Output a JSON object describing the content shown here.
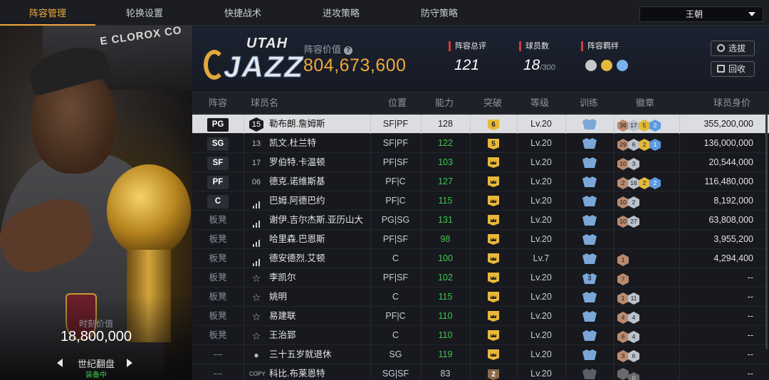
{
  "nav": {
    "tabs": [
      "阵容管理",
      "轮换设置",
      "快捷战术",
      "进攻策略",
      "防守策略"
    ],
    "active_tab": "阵容管理",
    "team_select": "王朝"
  },
  "card": {
    "wall_text": "E CLOROX CO",
    "value_label": "时刻价值",
    "value": "18,800,000",
    "name": "世纪翻盘",
    "status": "装备中"
  },
  "team": {
    "logo_top": "UTAH",
    "logo_main": "JAZZ",
    "lineup_value_label": "阵容价值",
    "lineup_value": "804,673,600",
    "rating_label": "阵容总评",
    "rating": "121",
    "players_label": "球员数",
    "players": "18",
    "players_max": "/300",
    "bond_label": "阵容羁绊",
    "bonds": [
      "#c8c8c8",
      "#e0b93d",
      "#7ab2ee"
    ],
    "btn_pick": "选拔",
    "btn_recycle": "回收"
  },
  "table": {
    "headers": [
      "阵容",
      "球员名",
      "位置",
      "能力",
      "突破",
      "等级",
      "训练",
      "徽章",
      "球员身价"
    ],
    "rows": [
      {
        "slot": "PG",
        "jersey": "15",
        "name": "勒布朗.詹姆斯",
        "pos": "SF|PF",
        "ability": "128",
        "ability_green": false,
        "brk": "6",
        "brk_type": "num",
        "level": "Lv.20",
        "train": "",
        "train_type": "blue",
        "badges": [
          [
            "br",
            "36"
          ],
          [
            "si",
            "17"
          ],
          [
            "go",
            "5"
          ],
          [
            "bl",
            "2"
          ]
        ],
        "salary": "355,200,000",
        "selected": true
      },
      {
        "slot": "SG",
        "jersey": "13",
        "name": "凯文.杜兰特",
        "pos": "SF|PF",
        "ability": "122",
        "ability_green": true,
        "brk": "5",
        "brk_type": "num",
        "level": "Lv.20",
        "train": "",
        "train_type": "blue",
        "badges": [
          [
            "br",
            "29"
          ],
          [
            "si",
            "6"
          ],
          [
            "go",
            "2"
          ],
          [
            "bl",
            "1"
          ]
        ],
        "salary": "136,000,000",
        "selected": false
      },
      {
        "slot": "SF",
        "jersey": "17",
        "name": "罗伯特.卡温顿",
        "pos": "PF|SF",
        "ability": "103",
        "ability_green": true,
        "brk": "",
        "brk_type": "crown",
        "level": "Lv.20",
        "train": "",
        "train_type": "blue",
        "badges": [
          [
            "br",
            "10"
          ],
          [
            "si",
            "3"
          ]
        ],
        "salary": "20,544,000",
        "selected": false
      },
      {
        "slot": "PF",
        "jersey": "06",
        "name": "德克.诺维斯基",
        "pos": "PF|C",
        "ability": "127",
        "ability_green": true,
        "brk": "",
        "brk_type": "crown",
        "level": "Lv.20",
        "train": "",
        "train_type": "blue",
        "badges": [
          [
            "br",
            "2"
          ],
          [
            "si",
            "16"
          ],
          [
            "go",
            "2"
          ],
          [
            "bl",
            "2"
          ]
        ],
        "salary": "116,480,000",
        "selected": false
      },
      {
        "slot": "C",
        "jersey": "bars",
        "name": "巴姆.阿德巴约",
        "pos": "PF|C",
        "ability": "115",
        "ability_green": true,
        "brk": "",
        "brk_type": "crown",
        "level": "Lv.20",
        "train": "",
        "train_type": "blue",
        "badges": [
          [
            "br",
            "10"
          ],
          [
            "si",
            "2"
          ]
        ],
        "salary": "8,192,000",
        "selected": false
      },
      {
        "slot": "板凳",
        "jersey": "bars",
        "name": "谢伊.吉尔杰斯.亚历山大",
        "pos": "PG|SG",
        "ability": "131",
        "ability_green": true,
        "brk": "",
        "brk_type": "crown",
        "level": "Lv.20",
        "train": "",
        "train_type": "blue",
        "badges": [
          [
            "br",
            "10"
          ],
          [
            "si",
            "27"
          ]
        ],
        "salary": "63,808,000",
        "selected": false
      },
      {
        "slot": "板凳",
        "jersey": "bars",
        "name": "哈里森.巴恩斯",
        "pos": "PF|SF",
        "ability": "98",
        "ability_green": true,
        "brk": "",
        "brk_type": "crown",
        "level": "Lv.20",
        "train": "",
        "train_type": "blue",
        "badges": [],
        "salary": "3,955,200",
        "selected": false
      },
      {
        "slot": "板凳",
        "jersey": "bars",
        "name": "德安德烈.艾顿",
        "pos": "C",
        "ability": "100",
        "ability_green": true,
        "brk": "",
        "brk_type": "crown",
        "level": "Lv.7",
        "train": "",
        "train_type": "blue",
        "badges": [
          [
            "br",
            "1"
          ]
        ],
        "salary": "4,294,400",
        "selected": false
      },
      {
        "slot": "板凳",
        "jersey": "star",
        "name": "李凯尔",
        "pos": "PF|SF",
        "ability": "102",
        "ability_green": true,
        "brk": "",
        "brk_type": "crown",
        "level": "Lv.20",
        "train": "3",
        "train_type": "blue",
        "badges": [
          [
            "br",
            "7"
          ]
        ],
        "salary": "--",
        "selected": false
      },
      {
        "slot": "板凳",
        "jersey": "star",
        "name": "姚明",
        "pos": "C",
        "ability": "115",
        "ability_green": true,
        "brk": "",
        "brk_type": "crown",
        "level": "Lv.20",
        "train": "",
        "train_type": "blue",
        "badges": [
          [
            "br",
            "1"
          ],
          [
            "si",
            "11"
          ]
        ],
        "salary": "--",
        "selected": false
      },
      {
        "slot": "板凳",
        "jersey": "star",
        "name": "易建联",
        "pos": "PF|C",
        "ability": "110",
        "ability_green": true,
        "brk": "",
        "brk_type": "crown",
        "level": "Lv.20",
        "train": "",
        "train_type": "blue",
        "badges": [
          [
            "br",
            "4"
          ],
          [
            "si",
            "4"
          ]
        ],
        "salary": "--",
        "selected": false
      },
      {
        "slot": "板凳",
        "jersey": "star",
        "name": "王治郅",
        "pos": "C",
        "ability": "110",
        "ability_green": true,
        "brk": "",
        "brk_type": "crown",
        "level": "Lv.20",
        "train": "",
        "train_type": "blue",
        "badges": [
          [
            "br",
            "6"
          ],
          [
            "si",
            "4"
          ]
        ],
        "salary": "--",
        "selected": false
      },
      {
        "slot": "---",
        "jersey": "person",
        "name": "三十五岁就退休",
        "pos": "SG",
        "ability": "119",
        "ability_green": true,
        "brk": "",
        "brk_type": "crown",
        "level": "Lv.20",
        "train": "",
        "train_type": "blue",
        "badges": [
          [
            "br",
            "3"
          ],
          [
            "si",
            "6"
          ]
        ],
        "salary": "--",
        "selected": false
      },
      {
        "slot": "---",
        "jersey": "COPY",
        "name": "科比.布莱恩特",
        "pos": "SG|SF",
        "ability": "83",
        "ability_green": false,
        "brk": "2",
        "brk_type": "brown",
        "level": "Lv.20",
        "train": "",
        "train_type": "gray",
        "badges": [
          [
            "dk",
            ""
          ],
          [
            "dk",
            "0"
          ]
        ],
        "salary": "--",
        "selected": false
      }
    ]
  }
}
